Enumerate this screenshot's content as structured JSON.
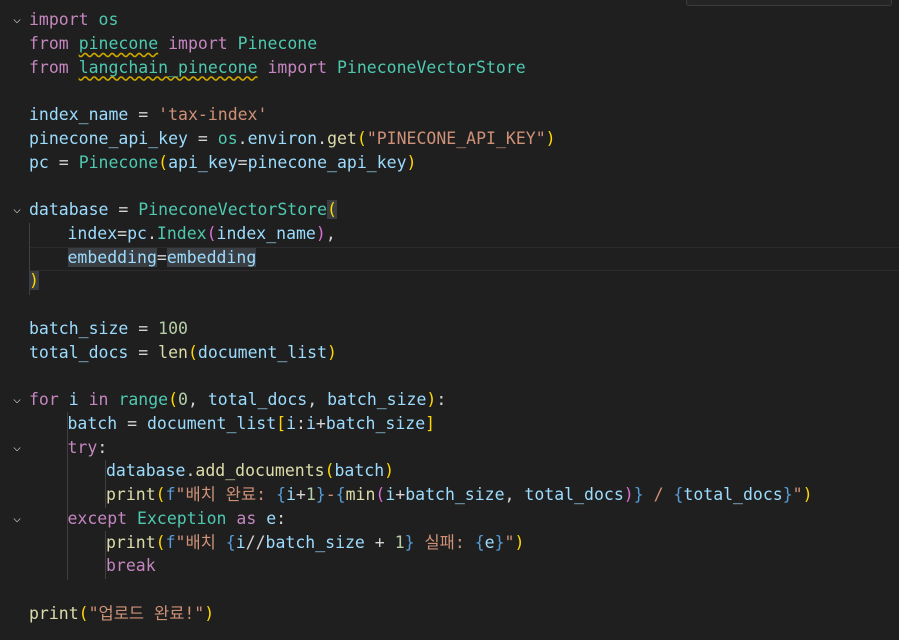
{
  "lines": [
    {
      "indent": 0,
      "tokens": [
        [
          "kwc",
          "import"
        ],
        [
          "plain",
          " "
        ],
        [
          "cls",
          "os"
        ]
      ]
    },
    {
      "indent": 0,
      "tokens": [
        [
          "kwc",
          "from"
        ],
        [
          "plain",
          " "
        ],
        [
          "cls squiggle",
          "pinecone"
        ],
        [
          "plain",
          " "
        ],
        [
          "kwc",
          "import"
        ],
        [
          "plain",
          " "
        ],
        [
          "cls",
          "Pinecone"
        ]
      ]
    },
    {
      "indent": 0,
      "tokens": [
        [
          "kwc",
          "from"
        ],
        [
          "plain",
          " "
        ],
        [
          "cls squiggle",
          "langchain_pinecone"
        ],
        [
          "plain",
          " "
        ],
        [
          "kwc",
          "import"
        ],
        [
          "plain",
          " "
        ],
        [
          "cls",
          "PineconeVectorStore"
        ]
      ]
    },
    {
      "indent": 0,
      "tokens": []
    },
    {
      "indent": 0,
      "tokens": [
        [
          "var",
          "index_name"
        ],
        [
          "plain",
          " = "
        ],
        [
          "str",
          "'tax-index'"
        ]
      ]
    },
    {
      "indent": 0,
      "tokens": [
        [
          "var",
          "pinecone_api_key"
        ],
        [
          "plain",
          " = "
        ],
        [
          "cls",
          "os"
        ],
        [
          "plain",
          "."
        ],
        [
          "var",
          "environ"
        ],
        [
          "plain",
          "."
        ],
        [
          "fn",
          "get"
        ],
        [
          "b1",
          "("
        ],
        [
          "str",
          "\"PINECONE_API_KEY\""
        ],
        [
          "b1",
          ")"
        ]
      ]
    },
    {
      "indent": 0,
      "tokens": [
        [
          "var",
          "pc"
        ],
        [
          "plain",
          " = "
        ],
        [
          "cls",
          "Pinecone"
        ],
        [
          "b1",
          "("
        ],
        [
          "var",
          "api_key"
        ],
        [
          "plain",
          "="
        ],
        [
          "var",
          "pinecone_api_key"
        ],
        [
          "b1",
          ")"
        ]
      ]
    },
    {
      "indent": 0,
      "tokens": []
    },
    {
      "indent": 0,
      "tokens": [
        [
          "var",
          "database"
        ],
        [
          "plain",
          " = "
        ],
        [
          "cls",
          "PineconeVectorStore"
        ],
        [
          "b1 highlight",
          "("
        ]
      ]
    },
    {
      "indent": 1,
      "tokens": [
        [
          "var",
          "index"
        ],
        [
          "plain",
          "="
        ],
        [
          "var",
          "pc"
        ],
        [
          "plain",
          "."
        ],
        [
          "cls",
          "Index"
        ],
        [
          "b2",
          "("
        ],
        [
          "var",
          "index_name"
        ],
        [
          "b2",
          ")"
        ],
        [
          "plain",
          ","
        ]
      ]
    },
    {
      "indent": 1,
      "tokens": [
        [
          "var highlight",
          "embedding"
        ],
        [
          "plain",
          "="
        ],
        [
          "var highlight",
          "embedding"
        ]
      ]
    },
    {
      "indent": 0,
      "tokens": [
        [
          "b1 highlight",
          ")"
        ]
      ]
    },
    {
      "indent": 0,
      "tokens": []
    },
    {
      "indent": 0,
      "tokens": [
        [
          "var",
          "batch_size"
        ],
        [
          "plain",
          " = "
        ],
        [
          "num",
          "100"
        ]
      ]
    },
    {
      "indent": 0,
      "tokens": [
        [
          "var",
          "total_docs"
        ],
        [
          "plain",
          " = "
        ],
        [
          "fn",
          "len"
        ],
        [
          "b1",
          "("
        ],
        [
          "var",
          "document_list"
        ],
        [
          "b1",
          ")"
        ]
      ]
    },
    {
      "indent": 0,
      "tokens": []
    },
    {
      "indent": 0,
      "tokens": [
        [
          "kwc",
          "for"
        ],
        [
          "plain",
          " "
        ],
        [
          "var",
          "i"
        ],
        [
          "plain",
          " "
        ],
        [
          "kwc",
          "in"
        ],
        [
          "plain",
          " "
        ],
        [
          "cls",
          "range"
        ],
        [
          "b1",
          "("
        ],
        [
          "num",
          "0"
        ],
        [
          "plain",
          ", "
        ],
        [
          "var",
          "total_docs"
        ],
        [
          "plain",
          ", "
        ],
        [
          "var",
          "batch_size"
        ],
        [
          "b1",
          ")"
        ],
        [
          "plain",
          ":"
        ]
      ]
    },
    {
      "indent": 1,
      "tokens": [
        [
          "var",
          "batch"
        ],
        [
          "plain",
          " = "
        ],
        [
          "var",
          "document_list"
        ],
        [
          "b1",
          "["
        ],
        [
          "var",
          "i"
        ],
        [
          "plain",
          ":"
        ],
        [
          "var",
          "i"
        ],
        [
          "plain",
          "+"
        ],
        [
          "var",
          "batch_size"
        ],
        [
          "b1",
          "]"
        ]
      ]
    },
    {
      "indent": 1,
      "tokens": [
        [
          "kwc",
          "try"
        ],
        [
          "plain",
          ":"
        ]
      ]
    },
    {
      "indent": 2,
      "tokens": [
        [
          "var",
          "database"
        ],
        [
          "plain",
          "."
        ],
        [
          "fn",
          "add_documents"
        ],
        [
          "b1",
          "("
        ],
        [
          "var",
          "batch"
        ],
        [
          "b1",
          ")"
        ]
      ]
    },
    {
      "indent": 2,
      "tokens": [
        [
          "fn",
          "print"
        ],
        [
          "b1",
          "("
        ],
        [
          "kw",
          "f"
        ],
        [
          "str",
          "\"배치 완료: "
        ],
        [
          "fbr",
          "{"
        ],
        [
          "var",
          "i"
        ],
        [
          "plain",
          "+"
        ],
        [
          "num",
          "1"
        ],
        [
          "fbr",
          "}"
        ],
        [
          "str",
          "-"
        ],
        [
          "fbr",
          "{"
        ],
        [
          "fn",
          "min"
        ],
        [
          "b2",
          "("
        ],
        [
          "var",
          "i"
        ],
        [
          "plain",
          "+"
        ],
        [
          "var",
          "batch_size"
        ],
        [
          "plain",
          ", "
        ],
        [
          "var",
          "total_docs"
        ],
        [
          "b2",
          ")"
        ],
        [
          "fbr",
          "}"
        ],
        [
          "str",
          " / "
        ],
        [
          "fbr",
          "{"
        ],
        [
          "var",
          "total_docs"
        ],
        [
          "fbr",
          "}"
        ],
        [
          "str",
          "\""
        ],
        [
          "b1",
          ")"
        ]
      ]
    },
    {
      "indent": 1,
      "tokens": [
        [
          "kwc",
          "except"
        ],
        [
          "plain",
          " "
        ],
        [
          "cls",
          "Exception"
        ],
        [
          "plain",
          " "
        ],
        [
          "kwc",
          "as"
        ],
        [
          "plain",
          " "
        ],
        [
          "var",
          "e"
        ],
        [
          "plain",
          ":"
        ]
      ]
    },
    {
      "indent": 2,
      "tokens": [
        [
          "fn",
          "print"
        ],
        [
          "b1",
          "("
        ],
        [
          "kw",
          "f"
        ],
        [
          "str",
          "\"배치 "
        ],
        [
          "fbr",
          "{"
        ],
        [
          "var",
          "i"
        ],
        [
          "plain",
          "//"
        ],
        [
          "var",
          "batch_size"
        ],
        [
          "plain",
          " + "
        ],
        [
          "num",
          "1"
        ],
        [
          "fbr",
          "}"
        ],
        [
          "str",
          " 실패: "
        ],
        [
          "fbr",
          "{"
        ],
        [
          "var",
          "e"
        ],
        [
          "fbr",
          "}"
        ],
        [
          "str",
          "\""
        ],
        [
          "b1",
          ")"
        ]
      ]
    },
    {
      "indent": 2,
      "tokens": [
        [
          "kwc",
          "break"
        ]
      ]
    },
    {
      "indent": 0,
      "tokens": []
    },
    {
      "indent": 0,
      "tokens": [
        [
          "fn",
          "print"
        ],
        [
          "b1",
          "("
        ],
        [
          "str",
          "\"업로드 완료!\""
        ],
        [
          "b1",
          ")"
        ]
      ]
    }
  ]
}
